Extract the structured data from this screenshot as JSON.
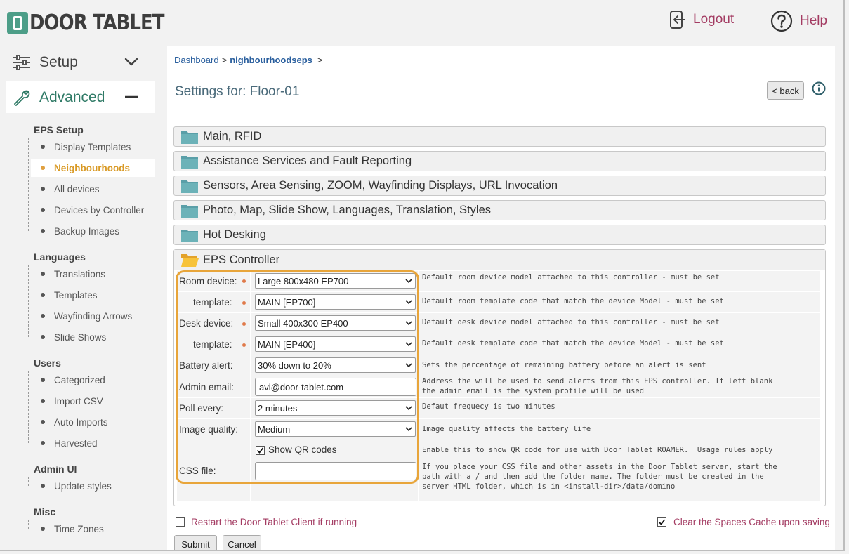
{
  "app": {
    "logo_text": "DOOR TABLET"
  },
  "header": {
    "logout_label": "Logout",
    "help_label": "Help"
  },
  "sidebar": {
    "setup_label": "Setup",
    "advanced_label": "Advanced",
    "sections": [
      {
        "title": "EPS Setup",
        "items": [
          "Display Templates",
          "Neighbourhoods",
          "All devices",
          "Devices by Controller",
          "Backup Images"
        ]
      },
      {
        "title": "Languages",
        "items": [
          "Translations",
          "Templates",
          "Wayfinding Arrows",
          "Slide Shows"
        ]
      },
      {
        "title": "Users",
        "items": [
          "Categorized",
          "Import CSV",
          "Auto Imports",
          "Harvested"
        ]
      },
      {
        "title": "Admin UI",
        "items": [
          "Update styles"
        ]
      },
      {
        "title": "Misc",
        "items": [
          "Time Zones"
        ]
      }
    ],
    "active_item": "Neighbourhoods"
  },
  "breadcrumb": {
    "root": "Dashboard",
    "current": "nighbourhoodseps",
    "sep": ">"
  },
  "page": {
    "title": "Settings for: Floor-01",
    "back_label": "< back"
  },
  "accordion": {
    "collapsed": [
      "Main, RFID",
      "Assistance Services and Fault Reporting",
      "Sensors, Area Sensing, ZOOM, Wayfinding Displays, URL Invocation",
      "Photo, Map, Slide Show, Languages, Translation, Styles",
      "Hot Desking"
    ],
    "open_title": "EPS Controller"
  },
  "form": {
    "room_device": {
      "label": "Room device:",
      "value": "Large 800x480 EP700",
      "desc": "Default room device model attached to this controller - must be set"
    },
    "room_template": {
      "label": "template:",
      "value": "MAIN [EP700]",
      "desc": "Default room template code that match the device Model - must be set"
    },
    "desk_device": {
      "label": "Desk device:",
      "value": "Small 400x300 EP400",
      "desc": "Default desk device model attached to this controller - must be set"
    },
    "desk_template": {
      "label": "template:",
      "value": "MAIN [EP400]",
      "desc": "Default desk template code that match the device Model - must be set"
    },
    "battery_alert": {
      "label": "Battery alert:",
      "value": "30% down to 20%",
      "desc": "Sets the percentage of remaining battery before an alert is sent"
    },
    "admin_email": {
      "label": "Admin email:",
      "value": "avi@door-tablet.com",
      "desc_line1": "Address the will be used to send alerts from this EPS controller. If left blank",
      "desc_line2": "the admin email is the system profile will be used"
    },
    "poll_every": {
      "label": "Poll every:",
      "value": "2 minutes",
      "desc": "Defaut frequecy is two minutes"
    },
    "image_quality": {
      "label": "Image quality:",
      "value": "Medium",
      "desc": "Image quality affects the battery life"
    },
    "show_qr": {
      "label": "Show QR codes",
      "checked": true,
      "desc": "Enable this to show QR code for use with Door Tablet ROAMER.  Usage rules apply"
    },
    "css_file": {
      "label": "CSS file:",
      "value": "",
      "desc_line1": "If you place your CSS file and other assets in the Door Tablet server, start the",
      "desc_line2": "path with a / and then add the folder name. The folder must be created in the",
      "desc_line3": "server HTML folder, which is in <install-dir>/data/domino"
    }
  },
  "footer": {
    "restart_label": "Restart the Door Tablet Client if running",
    "restart_checked": false,
    "clear_cache_label": "Clear the Spaces Cache upon saving",
    "clear_cache_checked": true,
    "submit_label": "Submit",
    "cancel_label": "Cancel"
  },
  "colors": {
    "accent": "#a33b62",
    "brand": "#4d9e88",
    "highlight": "#e8a53a",
    "active_nav": "#d99a26",
    "folder": "#5a9fa8"
  }
}
